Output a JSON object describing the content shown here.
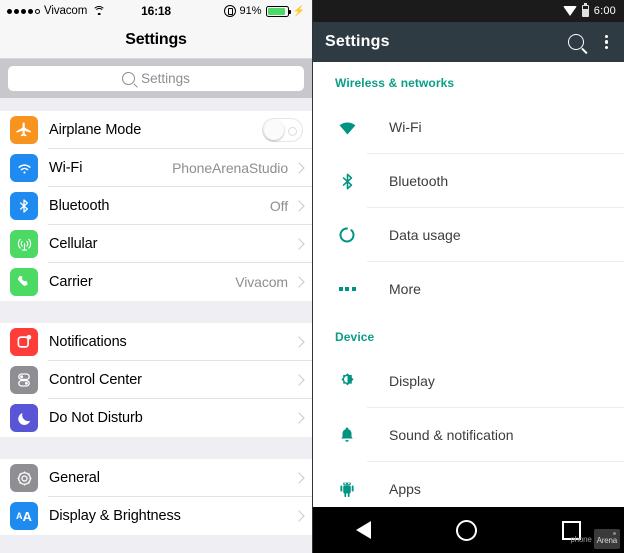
{
  "ios": {
    "status_bar": {
      "carrier": "Vivacom",
      "signal_dots_filled": 4,
      "signal_dots_hollow": 1,
      "wifi_icon": "wifi-icon",
      "time": "16:18",
      "rotation_lock_icon": "rotation-lock-icon",
      "battery_percent": "91%",
      "battery_level": 91,
      "battery_color": "#4cd964",
      "charging_icon": "⚡"
    },
    "navbar": {
      "title": "Settings"
    },
    "search": {
      "placeholder": "Settings",
      "icon": "search-icon"
    },
    "groups": [
      {
        "rows": [
          {
            "label": "Airplane Mode",
            "icon": "airplane-icon",
            "icon_bg": "#f7941e",
            "control": "toggle",
            "toggle_on": false
          },
          {
            "label": "Wi-Fi",
            "icon": "wifi-icon",
            "icon_bg": "#1f8aef",
            "value": "PhoneArenaStudio",
            "control": "chevron"
          },
          {
            "label": "Bluetooth",
            "icon": "bluetooth-icon",
            "icon_bg": "#1f8aef",
            "value": "Off",
            "control": "chevron"
          },
          {
            "label": "Cellular",
            "icon": "cellular-antenna-icon",
            "icon_bg": "#4cd964",
            "value": "",
            "control": "chevron"
          },
          {
            "label": "Carrier",
            "icon": "phone-icon",
            "icon_bg": "#4cd964",
            "value": "Vivacom",
            "control": "chevron"
          }
        ]
      },
      {
        "rows": [
          {
            "label": "Notifications",
            "icon": "notifications-icon",
            "icon_bg": "#fc3d39",
            "value": "",
            "control": "chevron"
          },
          {
            "label": "Control Center",
            "icon": "control-center-icon",
            "icon_bg": "#8e8e93",
            "value": "",
            "control": "chevron"
          },
          {
            "label": "Do Not Disturb",
            "icon": "moon-icon",
            "icon_bg": "#5856d6",
            "value": "",
            "control": "chevron"
          }
        ]
      },
      {
        "rows": [
          {
            "label": "General",
            "icon": "gear-icon",
            "icon_bg": "#8e8e93",
            "value": "",
            "control": "chevron"
          },
          {
            "label": "Display & Brightness",
            "icon": "text-size-icon",
            "icon_bg": "#1f8aef",
            "value": "",
            "control": "chevron"
          }
        ]
      }
    ]
  },
  "android": {
    "status_bar": {
      "wifi_icon": "wifi-icon",
      "battery_icon": "battery-icon",
      "time": "6:00"
    },
    "appbar": {
      "title": "Settings",
      "search_icon": "search-icon",
      "overflow_icon": "overflow-menu-icon"
    },
    "accent_color": "#009482",
    "sections": [
      {
        "header": "Wireless & networks",
        "rows": [
          {
            "label": "Wi-Fi",
            "icon": "wifi-icon"
          },
          {
            "label": "Bluetooth",
            "icon": "bluetooth-icon"
          },
          {
            "label": "Data usage",
            "icon": "data-usage-icon"
          },
          {
            "label": "More",
            "icon": "more-dots-icon"
          }
        ]
      },
      {
        "header": "Device",
        "rows": [
          {
            "label": "Display",
            "icon": "brightness-icon"
          },
          {
            "label": "Sound & notification",
            "icon": "bell-icon"
          },
          {
            "label": "Apps",
            "icon": "android-robot-icon"
          }
        ]
      }
    ],
    "navbar": {
      "back_icon": "back-triangle-icon",
      "home_icon": "home-circle-icon",
      "recents_icon": "recents-square-icon"
    },
    "watermark": {
      "text": "phone",
      "badge": "Arena"
    }
  }
}
